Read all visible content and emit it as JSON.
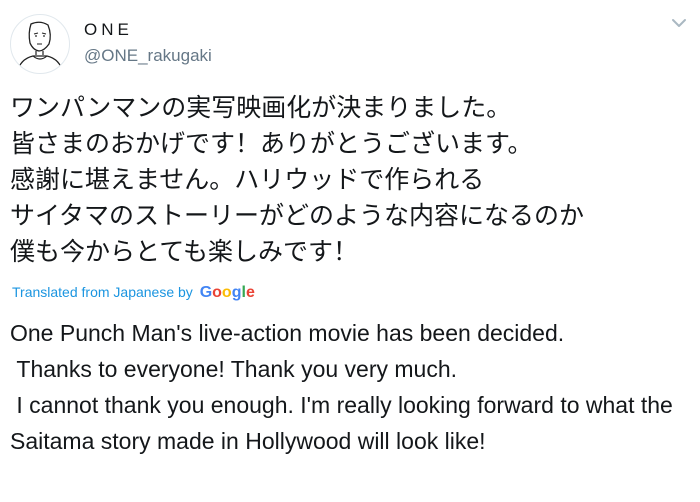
{
  "user": {
    "display_name": "ONE",
    "handle": "@ONE_rakugaki",
    "avatar_icon": "character-sketch-avatar"
  },
  "menu": {
    "icon": "chevron-down-icon",
    "color": "#aab8c2"
  },
  "tweet": {
    "original_lines": [
      "ワンパンマンの実写映画化が決まりました。",
      "皆さまのおかげです！ありがとうございます。",
      "感謝に堪えません。ハリウッドで作られる",
      "サイタマのストーリーがどのような内容になるのか",
      "僕も今からとても楽しみです！"
    ],
    "translation_prefix": "Translated from Japanese by",
    "translation_provider": "Google",
    "translation_text": "One Punch Man's live-action movie has been decided.\n Thanks to everyone! Thank you very much.\n I cannot thank you enough. I'm really looking forward to what the Saitama story made in Hollywood will look like!"
  },
  "colors": {
    "link": "#1b95e0",
    "secondary_text": "#657786",
    "primary_text": "#14171a"
  }
}
